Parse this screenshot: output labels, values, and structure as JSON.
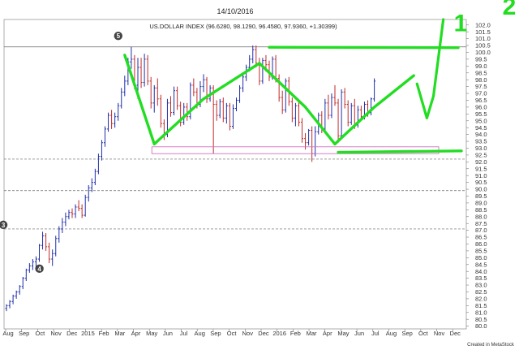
{
  "chart_data": {
    "type": "bar",
    "subtype": "ohlc",
    "date": "14/10/2016",
    "title": "US.DOLLAR INDEX (96.6280, 98.1290, 96.4580, 97.9360, +1.30399)",
    "footer": "Created in MetaStock",
    "ylim": [
      79.8,
      102.4
    ],
    "y_ticks": [
      80.0,
      80.5,
      81.0,
      81.5,
      82.0,
      82.5,
      83.0,
      83.5,
      84.0,
      84.5,
      85.0,
      85.5,
      86.0,
      86.5,
      87.0,
      87.5,
      88.0,
      88.5,
      89.0,
      89.5,
      90.0,
      90.5,
      91.0,
      91.5,
      92.0,
      92.5,
      93.0,
      93.5,
      94.0,
      94.5,
      95.0,
      95.5,
      96.0,
      96.5,
      97.0,
      97.5,
      98.0,
      98.5,
      99.0,
      99.5,
      100.0,
      100.5,
      101.0,
      101.5,
      102.0
    ],
    "x_ticks": [
      "Aug",
      "Sep",
      "Oct",
      "Nov",
      "Dec",
      "2015",
      "Feb",
      "Mar",
      "Apr",
      "May",
      "Jun",
      "Jul",
      "Aug",
      "Sep",
      "Oct",
      "Nov",
      "Dec",
      "2016",
      "Feb",
      "Mar",
      "Apr",
      "May",
      "Jun",
      "Jul",
      "Aug",
      "Sep",
      "Oct",
      "Nov",
      "Dec"
    ],
    "price_bars": [
      [
        81.3,
        81.6,
        81.1,
        81.5
      ],
      [
        81.5,
        81.9,
        81.3,
        81.8
      ],
      [
        81.8,
        82.3,
        81.6,
        82.2
      ],
      [
        82.2,
        82.6,
        82.0,
        82.5
      ],
      [
        82.5,
        83.0,
        82.3,
        82.9
      ],
      [
        82.9,
        83.6,
        82.7,
        83.5
      ],
      [
        83.5,
        84.2,
        83.3,
        84.1
      ],
      [
        84.1,
        84.6,
        83.9,
        84.4
      ],
      [
        84.4,
        84.9,
        84.1,
        84.7
      ],
      [
        84.7,
        85.1,
        84.3,
        84.9
      ],
      [
        84.9,
        86.0,
        84.7,
        85.9
      ],
      [
        85.9,
        86.9,
        85.6,
        86.6
      ],
      [
        86.6,
        86.8,
        85.5,
        85.8
      ],
      [
        85.8,
        86.1,
        84.6,
        84.9
      ],
      [
        84.9,
        85.6,
        84.4,
        85.3
      ],
      [
        85.3,
        86.6,
        85.1,
        86.4
      ],
      [
        86.4,
        87.3,
        86.1,
        87.1
      ],
      [
        87.1,
        87.9,
        86.8,
        87.6
      ],
      [
        87.6,
        88.3,
        87.3,
        88.0
      ],
      [
        88.0,
        88.5,
        87.8,
        88.3
      ],
      [
        88.3,
        88.6,
        87.9,
        88.2
      ],
      [
        88.2,
        88.9,
        87.9,
        88.7
      ],
      [
        88.7,
        89.2,
        88.4,
        88.6
      ],
      [
        88.6,
        88.9,
        87.9,
        88.1
      ],
      [
        88.1,
        89.6,
        88.0,
        89.4
      ],
      [
        89.4,
        90.3,
        89.1,
        90.1
      ],
      [
        90.1,
        90.8,
        89.8,
        90.5
      ],
      [
        90.5,
        91.5,
        90.3,
        91.3
      ],
      [
        91.3,
        92.6,
        91.1,
        92.4
      ],
      [
        92.4,
        93.6,
        92.1,
        93.4
      ],
      [
        93.4,
        94.6,
        93.1,
        94.4
      ],
      [
        94.4,
        95.6,
        94.2,
        95.4
      ],
      [
        95.4,
        95.8,
        94.4,
        94.8
      ],
      [
        94.8,
        95.6,
        94.5,
        95.3
      ],
      [
        95.3,
        96.3,
        95.0,
        96.1
      ],
      [
        96.1,
        97.4,
        95.9,
        97.1
      ],
      [
        97.1,
        98.3,
        96.8,
        97.9
      ],
      [
        97.9,
        99.6,
        97.6,
        99.3
      ],
      [
        99.3,
        100.4,
        98.8,
        99.5
      ],
      [
        99.5,
        99.8,
        97.3,
        97.6
      ],
      [
        97.6,
        99.6,
        96.6,
        98.9
      ],
      [
        98.9,
        99.6,
        97.4,
        97.8
      ],
      [
        97.8,
        99.9,
        97.5,
        99.5
      ],
      [
        99.5,
        99.8,
        97.6,
        97.9
      ],
      [
        97.9,
        98.2,
        95.9,
        96.3
      ],
      [
        96.3,
        97.6,
        95.6,
        97.4
      ],
      [
        97.4,
        98.1,
        96.1,
        96.6
      ],
      [
        96.6,
        96.9,
        94.5,
        94.8
      ],
      [
        94.8,
        95.1,
        93.6,
        94.0
      ],
      [
        94.0,
        96.6,
        93.8,
        96.3
      ],
      [
        96.3,
        96.8,
        95.3,
        95.6
      ],
      [
        95.6,
        97.5,
        95.4,
        97.2
      ],
      [
        97.2,
        97.5,
        95.8,
        96.1
      ],
      [
        96.1,
        96.4,
        94.6,
        94.9
      ],
      [
        94.9,
        96.3,
        94.7,
        96.0
      ],
      [
        96.0,
        96.3,
        95.0,
        95.3
      ],
      [
        95.3,
        97.8,
        95.1,
        97.6
      ],
      [
        97.6,
        98.1,
        96.8,
        97.1
      ],
      [
        97.1,
        97.4,
        95.9,
        96.2
      ],
      [
        96.2,
        97.9,
        96.0,
        97.5
      ],
      [
        97.5,
        98.4,
        97.1,
        98.0
      ],
      [
        98.0,
        98.2,
        96.3,
        96.6
      ],
      [
        96.6,
        97.6,
        96.4,
        97.4
      ],
      [
        97.4,
        97.6,
        92.6,
        96.2
      ],
      [
        96.2,
        96.5,
        95.0,
        95.4
      ],
      [
        95.4,
        96.6,
        95.2,
        96.4
      ],
      [
        96.4,
        96.7,
        94.9,
        95.2
      ],
      [
        95.2,
        96.3,
        94.8,
        96.1
      ],
      [
        96.1,
        96.3,
        94.3,
        94.6
      ],
      [
        94.6,
        96.2,
        94.4,
        95.9
      ],
      [
        95.9,
        96.7,
        95.7,
        96.5
      ],
      [
        96.5,
        97.6,
        96.3,
        97.4
      ],
      [
        97.4,
        98.4,
        97.1,
        98.2
      ],
      [
        98.2,
        99.1,
        97.9,
        98.9
      ],
      [
        98.9,
        99.8,
        98.6,
        99.5
      ],
      [
        99.5,
        100.5,
        99.2,
        100.2
      ],
      [
        100.2,
        100.5,
        98.9,
        99.2
      ],
      [
        99.2,
        99.6,
        97.6,
        97.9
      ],
      [
        97.9,
        99.6,
        97.7,
        99.4
      ],
      [
        99.4,
        99.8,
        98.6,
        99.1
      ],
      [
        99.1,
        99.4,
        97.9,
        98.2
      ],
      [
        98.2,
        99.7,
        98.0,
        99.5
      ],
      [
        99.5,
        99.8,
        97.8,
        98.1
      ],
      [
        98.1,
        98.4,
        96.4,
        96.7
      ],
      [
        96.7,
        97.2,
        95.5,
        95.8
      ],
      [
        95.8,
        98.1,
        95.6,
        97.9
      ],
      [
        97.9,
        98.2,
        96.1,
        96.4
      ],
      [
        96.4,
        96.7,
        94.9,
        95.2
      ],
      [
        95.2,
        96.3,
        94.6,
        96.1
      ],
      [
        96.1,
        96.4,
        94.6,
        94.9
      ],
      [
        94.9,
        95.2,
        93.4,
        93.7
      ],
      [
        93.7,
        94.1,
        92.9,
        93.4
      ],
      [
        93.4,
        94.4,
        93.2,
        94.3
      ],
      [
        94.3,
        94.6,
        92.0,
        92.6
      ],
      [
        92.6,
        94.6,
        92.4,
        94.2
      ],
      [
        94.2,
        95.6,
        94.0,
        95.4
      ],
      [
        95.4,
        95.7,
        94.1,
        94.4
      ],
      [
        94.4,
        96.6,
        94.2,
        96.3
      ],
      [
        96.3,
        96.9,
        95.1,
        95.4
      ],
      [
        95.4,
        97.0,
        95.2,
        96.7
      ],
      [
        96.7,
        97.6,
        96.1,
        96.3
      ],
      [
        96.3,
        96.6,
        93.4,
        93.9
      ],
      [
        93.9,
        97.3,
        93.7,
        97.1
      ],
      [
        97.1,
        97.4,
        95.9,
        96.2
      ],
      [
        96.2,
        96.5,
        94.6,
        94.9
      ],
      [
        94.9,
        96.3,
        94.7,
        96.1
      ],
      [
        96.1,
        96.6,
        94.4,
        94.7
      ],
      [
        94.7,
        96.1,
        94.5,
        95.8
      ],
      [
        95.8,
        96.1,
        95.0,
        95.3
      ],
      [
        95.3,
        96.4,
        95.1,
        96.2
      ],
      [
        96.2,
        96.5,
        95.3,
        95.6
      ],
      [
        95.6,
        96.7,
        95.4,
        96.6
      ],
      [
        96.6,
        98.1,
        96.4,
        97.9
      ]
    ],
    "support_levels": [
      92.2,
      89.9,
      87.1
    ],
    "resistance_level": 100.4,
    "consolidation_box": [
      92.6,
      93.1
    ],
    "wave_labels": [
      {
        "label": "5",
        "bar": 36,
        "price": 101.2
      },
      {
        "label": "3",
        "bar": 1,
        "price": 87.4
      },
      {
        "label": "4",
        "bar": 12,
        "price": 84.2
      }
    ],
    "projection_labels": [
      {
        "label": "1",
        "price": 101.9
      },
      {
        "label": "2",
        "price": 103.1
      }
    ],
    "hand_drawn_path_points": [
      [
        36,
        99.8
      ],
      [
        45,
        93.3
      ],
      [
        60,
        96.6
      ],
      [
        77,
        99.2
      ],
      [
        91,
        96.0
      ],
      [
        100,
        93.3
      ],
      [
        112,
        96.0
      ],
      [
        124,
        98.3
      ]
    ],
    "hand_drawn_wave2_points": [
      [
        125,
        97.7
      ],
      [
        128,
        95.2
      ],
      [
        130,
        96.8
      ],
      [
        133,
        102.4
      ]
    ],
    "colors": {
      "up_bar": "#1f2fa8",
      "down_bar": "#c22a2a",
      "annotation": "#22dd22",
      "box": "#d070c0",
      "grid": "#666666",
      "resistance": "#666666"
    }
  }
}
